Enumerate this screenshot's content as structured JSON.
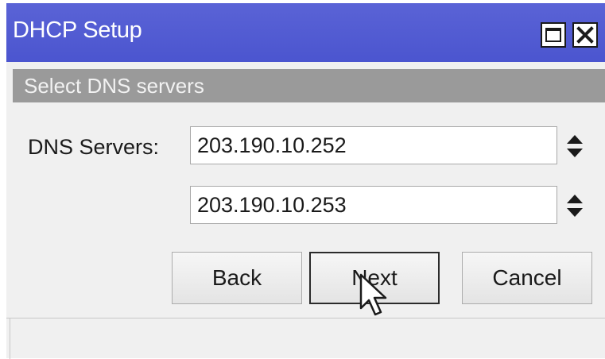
{
  "window": {
    "title": "DHCP Setup",
    "title_color": "#4b55cf"
  },
  "titlebar_buttons": {
    "maximize_icon": "maximize-icon",
    "close_icon": "close-icon"
  },
  "section": {
    "header": "Select DNS servers"
  },
  "form": {
    "dns_label": "DNS Servers:",
    "dns_servers": [
      "203.190.10.252",
      "203.190.10.253"
    ],
    "spin_icon": "up-down-arrows-icon"
  },
  "buttons": {
    "back": "Back",
    "next": "Next",
    "cancel": "Cancel"
  }
}
